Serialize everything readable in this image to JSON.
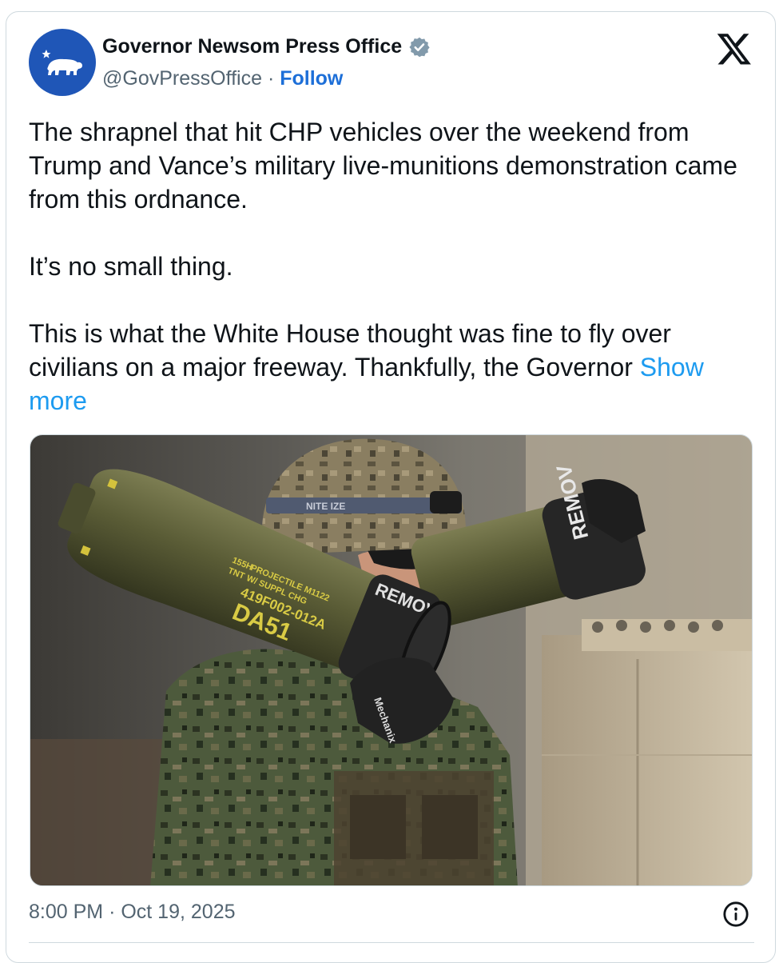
{
  "account": {
    "name": "Governor Newsom Press Office",
    "handle": "@GovPressOffice",
    "separator": "·",
    "follow_label": "Follow",
    "verified_color": "#829aab"
  },
  "tweet": {
    "paragraph1": "The shrapnel that hit CHP vehicles over the weekend from Trump and Vance’s military live-munitions demonstration came from this ordnance.",
    "paragraph2": "It’s no small thing.",
    "paragraph3": "This is what the White House thought was fine to fly over civilians on a major freeway. Thankfully, the Governor",
    "show_more": "Show more"
  },
  "media": {
    "shell_markings_1": "155H",
    "shell_markings_2": "TNT",
    "shell_markings_3": "PROJECTILE M1122",
    "shell_markings_4": "W/ SUPPL CHG",
    "shell_lot": "419F002-012A",
    "shell_code": "DA51",
    "sleeve_text_1": "REMOVE",
    "sleeve_text_2": "REMOV",
    "glove_text": "Mechanix",
    "helmet_band": "NITE IZE"
  },
  "footer": {
    "time": "8:00 PM",
    "separator": "·",
    "date": "Oct 19, 2025"
  },
  "icons": {
    "avatar": "california-bear-icon",
    "verified": "verified-badge-icon",
    "platform": "x-logo-icon",
    "info": "info-icon"
  },
  "colors": {
    "link": "#1d9bf0",
    "follow": "#1d6fd8",
    "avatar_bg": "#1f56b7",
    "muted_text": "#536471"
  }
}
